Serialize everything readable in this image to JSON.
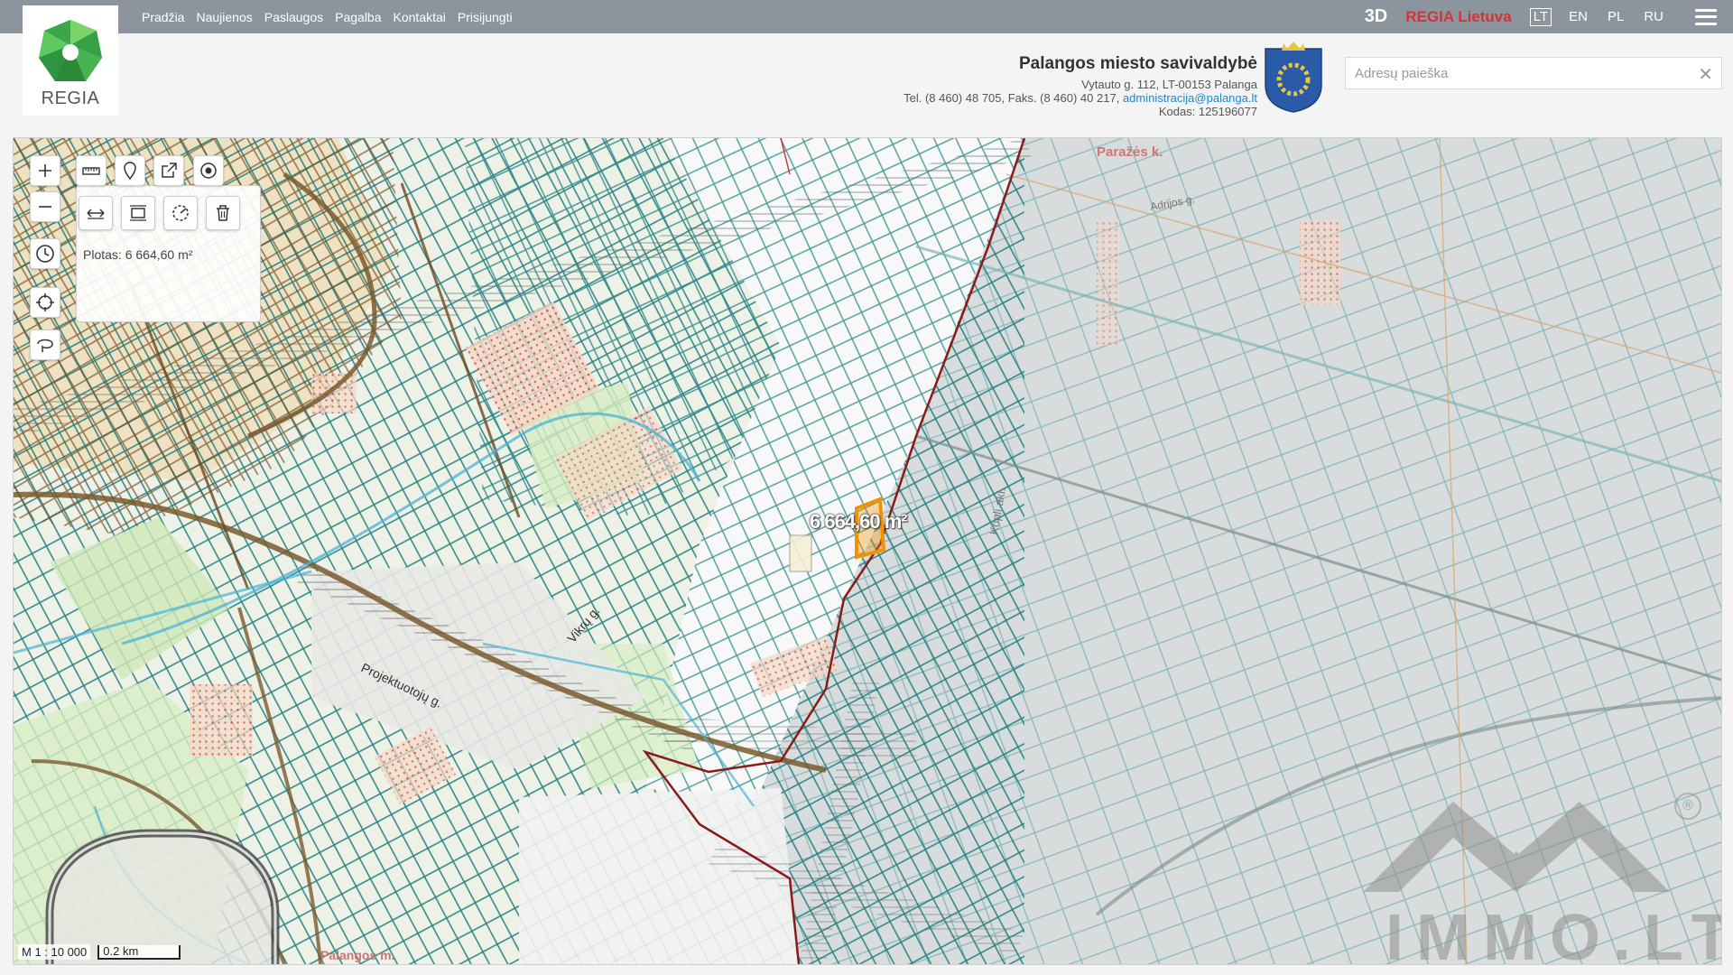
{
  "nav": {
    "items": [
      "Pradžia",
      "Naujienos",
      "Paslaugos",
      "Pagalba",
      "Kontaktai",
      "Prisijungti"
    ],
    "btn_3d": "3D",
    "regia_lietuva": "REGIA Lietuva",
    "languages": [
      "LT",
      "EN",
      "PL",
      "RU"
    ],
    "active_language": "LT"
  },
  "logo": {
    "text": "REGIA"
  },
  "municipality": {
    "name": "Palangos miesto savivaldybė",
    "address": "Vytauto g. 112, LT-00153 Palanga",
    "phone": "Tel. (8 460) 48 705, Faks. (8 460) 40 217,",
    "email": "administracija@palanga.lt",
    "code": "Kodas: 125196077"
  },
  "search": {
    "placeholder": "Adresų paieška",
    "value": ""
  },
  "map": {
    "area_text": "Plotas: 6 664,60 m²",
    "measure_label": "6 664,60 m²",
    "scale_ratio": "M 1 : 10 000",
    "scale_bar": "0.2 km",
    "watermark": "IMMO.LT",
    "registered_mark": "®"
  },
  "colors": {
    "topbar": "#8c959d",
    "regia_red": "#d2343a",
    "parcel_teal": "#2a8a8a",
    "road_brown": "#7a5a2e",
    "boundary_red": "#8b1a1a",
    "highlight_orange": "#f39200"
  }
}
